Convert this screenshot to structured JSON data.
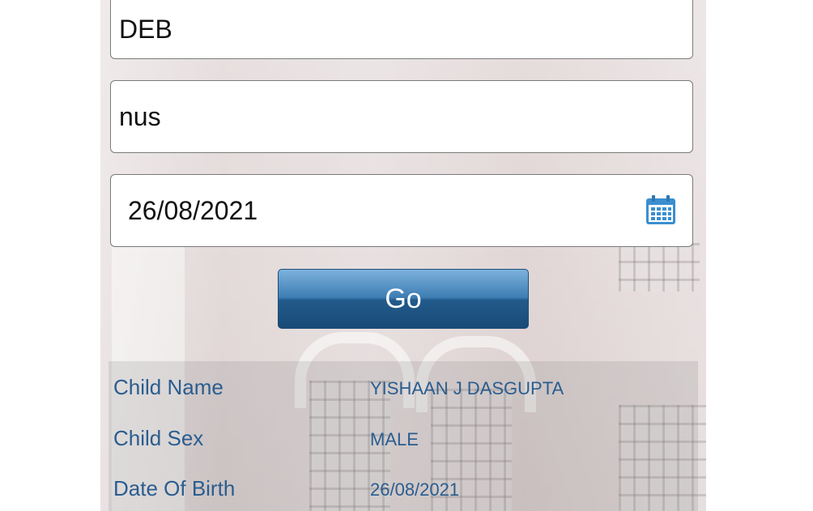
{
  "form": {
    "first_name_value": "DEB",
    "last_name_value": "nus",
    "date_value": "26/08/2021",
    "date_icon": "calendar-icon",
    "go_label": "Go"
  },
  "results": {
    "rows": [
      {
        "label": "Child Name",
        "value": "YISHAAN J DASGUPTA"
      },
      {
        "label": "Child Sex",
        "value": "MALE"
      },
      {
        "label": "Date Of Birth",
        "value": "26/08/2021"
      }
    ]
  },
  "colors": {
    "accent": "#2a5d8f",
    "button": "#225b8c",
    "icon": "#3a8fd0"
  }
}
